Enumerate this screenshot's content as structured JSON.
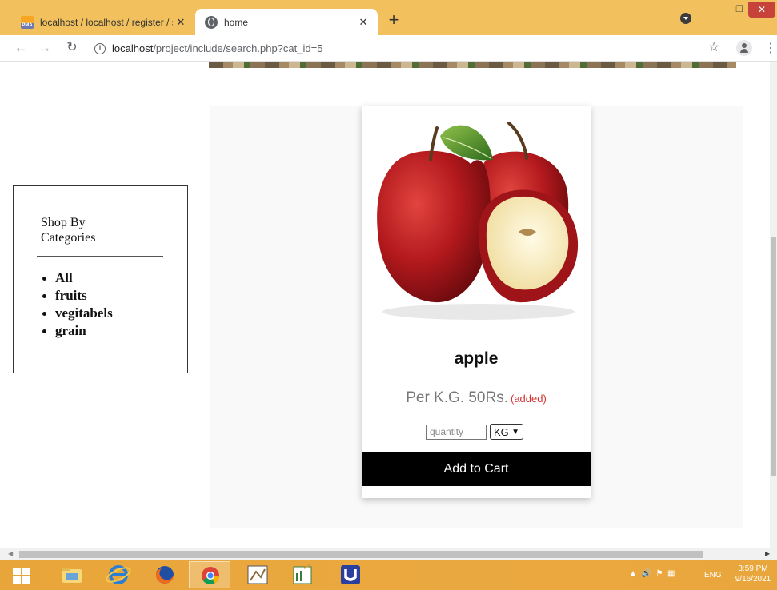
{
  "browser": {
    "tabs": [
      {
        "title": "localhost / localhost / register / s",
        "favicon": "phpmyadmin-icon",
        "active": false
      },
      {
        "title": "home",
        "favicon": "globe-icon",
        "active": true
      }
    ],
    "new_tab_label": "+",
    "address": {
      "host": "localhost",
      "path": "/project/include/search.php?cat_id=5"
    }
  },
  "sidebar": {
    "heading": "Shop By Categories",
    "categories": [
      "All",
      "fruits",
      "vegitabels",
      "grain"
    ]
  },
  "product": {
    "name": "apple",
    "price": "Per K.G. 50Rs.",
    "status": "(added)",
    "quantity_placeholder": "quantity",
    "unit_selected": "KG",
    "add_button": "Add to Cart"
  },
  "taskbar": {
    "language": "ENG",
    "time": "3:59 PM",
    "date": "9/16/2021"
  },
  "colors": {
    "tabbar": "#f2c15e",
    "button": "#000000",
    "status_text": "#d43131"
  }
}
